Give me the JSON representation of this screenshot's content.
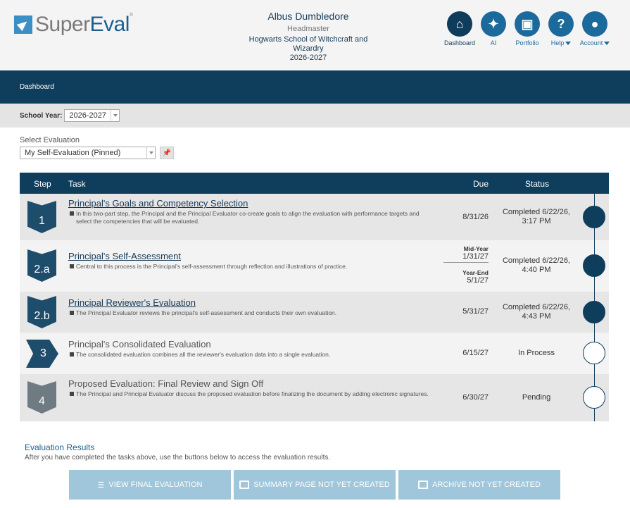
{
  "header": {
    "logo": {
      "part1": "Super",
      "part2": "Eval",
      "tm": "®"
    },
    "user": {
      "name": "Albus Dumbledore",
      "role": "Headmaster",
      "school": "Hogwarts School of Witchcraft and Wizardry",
      "year": "2026-2027"
    },
    "nav": [
      {
        "label": "Dashboard",
        "icon": "home-icon",
        "glyph": "⌂"
      },
      {
        "label": "AI",
        "icon": "sparkle-icon",
        "glyph": "✦"
      },
      {
        "label": "Portfolio",
        "icon": "briefcase-icon",
        "glyph": "▣"
      },
      {
        "label": "Help",
        "icon": "question-icon",
        "glyph": "?"
      },
      {
        "label": "Account",
        "icon": "user-icon",
        "glyph": "●"
      }
    ]
  },
  "breadcrumb": {
    "dashboard": "Dashboard"
  },
  "school_year": {
    "label": "School Year:",
    "value": "2026-2027"
  },
  "evaluation_select": {
    "label": "Select Evaluation",
    "value": "My Self-Evaluation (Pinned)"
  },
  "table": {
    "headers": {
      "step": "Step",
      "task": "Task",
      "due": "Due",
      "status": "Status"
    },
    "rows": [
      {
        "step": "1",
        "title": "Principal's Goals and Competency Selection",
        "desc": "In this two-part step, the Principal and the Principal Evaluator co-create goals to align the evaluation with performance targets and select the competencies that will be evaluated.",
        "due": "8/31/26",
        "status": "Completed 6/22/26, 3:17 PM"
      },
      {
        "step": "2.a",
        "title": "Principal's Self-Assessment",
        "desc": "Central to this process is the Principal's self-assessment through reflection and illustrations of practice.",
        "due_mid_label": "Mid-Year",
        "due_mid": "1/31/27",
        "due_end_label": "Year-End",
        "due_end": "5/1/27",
        "status": "Completed 6/22/26, 4:40 PM"
      },
      {
        "step": "2.b",
        "title": "Principal Reviewer's Evaluation",
        "desc": "The Principal Evaluator reviews the principal's self-assessment and conducts their own evaluation.",
        "due": "5/31/27",
        "status": "Completed 6/22/26, 4:43 PM"
      },
      {
        "step": "3",
        "title": "Principal's Consolidated Evaluation",
        "desc": "The consolidated evaluation combines all the reviewer's evaluation data into a single evaluation.",
        "due": "6/15/27",
        "status": "In Process"
      },
      {
        "step": "4",
        "title": "Proposed Evaluation: Final Review and Sign Off",
        "desc": "The Principal and Principal Evaluator discuss the proposed evaluation before finalizing the document by adding electronic signatures.",
        "due": "6/30/27",
        "status": "Pending"
      }
    ]
  },
  "results": {
    "title": "Evaluation Results",
    "subtitle": "After you have completed the tasks above, use the buttons below to access the evaluation results.",
    "buttons": {
      "view_final": "VIEW FINAL EVALUATION",
      "summary": "SUMMARY PAGE NOT YET CREATED",
      "archive": "ARCHIVE NOT YET CREATED"
    }
  },
  "colors": {
    "navy": "#0f3e5c",
    "accent": "#1c6a9b",
    "button_disabled": "#9fc6da"
  }
}
